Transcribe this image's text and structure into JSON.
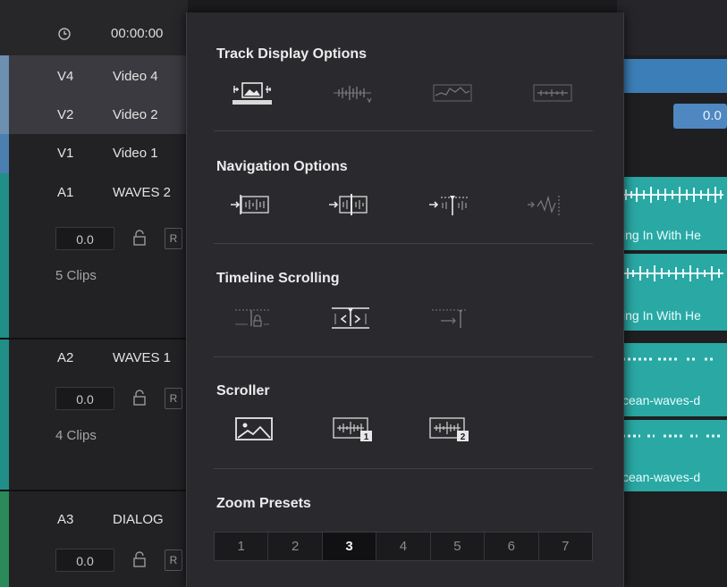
{
  "timecode": "00:00:00",
  "tracks": [
    {
      "id": "V4",
      "name": "Video 4"
    },
    {
      "id": "V2",
      "name": "Video 2"
    },
    {
      "id": "V1",
      "name": "Video 1"
    },
    {
      "id": "A1",
      "name": "WAVES 2",
      "volume": "0.0",
      "r": "R",
      "clips": "5 Clips"
    },
    {
      "id": "A2",
      "name": "WAVES 1",
      "volume": "0.0",
      "r": "R",
      "clips": "4 Clips"
    },
    {
      "id": "A3",
      "name": "DIALOG",
      "volume": "0.0",
      "r": "R"
    }
  ],
  "timeline": {
    "video_clip_value": "0.0",
    "clip_labels": [
      "ing In With He",
      "ing In With He",
      "cean-waves-d",
      "cean-waves-d"
    ]
  },
  "popup": {
    "sections": [
      {
        "title": "Track Display Options",
        "options": [
          "thumbnail-waveform-icon",
          "waveform-only-icon",
          "waveform-line-icon",
          "waveform-compact-icon"
        ],
        "selected": 0
      },
      {
        "title": "Navigation Options",
        "options": [
          "snap-clip-icon",
          "snap-edit-icon",
          "snap-playhead-icon",
          "snap-waveform-icon"
        ],
        "selected": -1
      },
      {
        "title": "Timeline Scrolling",
        "options": [
          "no-scroll-icon",
          "page-scroll-icon",
          "smooth-scroll-icon"
        ],
        "selected": 1
      },
      {
        "title": "Scroller",
        "options": [
          "image-scroller-icon",
          "waveform-scroller-1-icon",
          "waveform-scroller-2-icon"
        ],
        "selected": 0
      },
      {
        "title": "Zoom Presets"
      }
    ],
    "zoom_presets": [
      "1",
      "2",
      "3",
      "4",
      "5",
      "6",
      "7"
    ],
    "zoom_selected": "3"
  },
  "colors": {
    "video_edge": "#5a8fbf",
    "audio_edge": "#1f8f87",
    "audio_clip": "#2aa8a4",
    "video_clip": "#3c7fb8"
  }
}
